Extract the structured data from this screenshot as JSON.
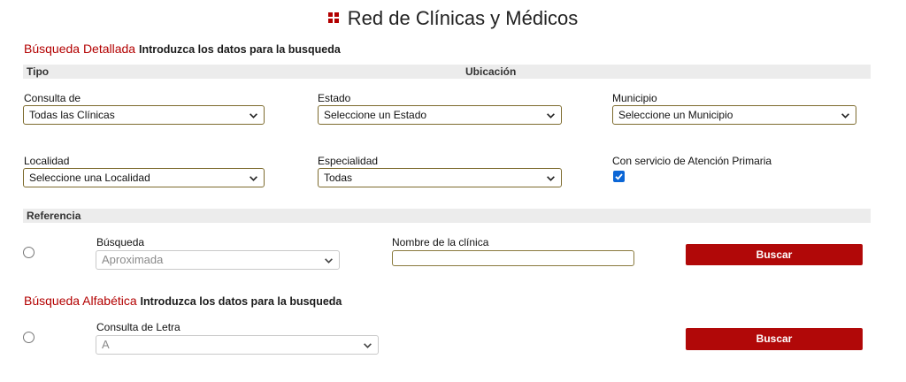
{
  "page": {
    "title": "Red de Clínicas y Médicos"
  },
  "detailed": {
    "heading": "Búsqueda Detallada",
    "subheading": "Introduzca los datos para la busqueda",
    "bar": {
      "tipo": "Tipo",
      "ubicacion": "Ubicación"
    },
    "consulta": {
      "label": "Consulta de",
      "value": "Todas las Clínicas"
    },
    "estado": {
      "label": "Estado",
      "value": "Seleccione un Estado"
    },
    "municipio": {
      "label": "Municipio",
      "value": "Seleccione un Municipio"
    },
    "localidad": {
      "label": "Localidad",
      "value": "Seleccione una Localidad"
    },
    "especialidad": {
      "label": "Especialidad",
      "value": "Todas"
    },
    "atencion": {
      "label": "Con servicio de Atención Primaria",
      "checked": true
    }
  },
  "referencia": {
    "bar": "Referencia",
    "busqueda": {
      "label": "Búsqueda",
      "value": "Aproximada"
    },
    "nombre": {
      "label": "Nombre de la clínica",
      "value": ""
    },
    "button": "Buscar"
  },
  "alfabetica": {
    "heading": "Búsqueda Alfabética",
    "subheading": "Introduzca los datos para la busqueda",
    "letra": {
      "label": "Consulta de Letra",
      "value": "A"
    },
    "button": "Buscar"
  },
  "colors": {
    "accent": "#b30000",
    "button": "#b10808",
    "bar": "#ececec",
    "checkbox": "#0b66d6"
  }
}
